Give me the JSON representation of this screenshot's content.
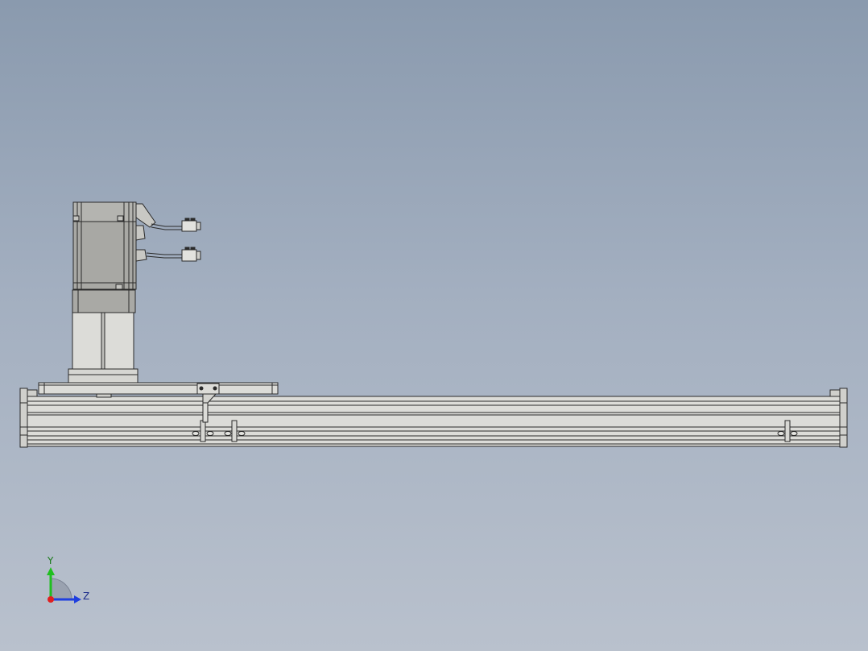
{
  "viewport": {
    "background_top": "#8a9aae",
    "background_bottom": "#b9c1cd",
    "part_fill": "#d8d8d4",
    "part_stroke": "#2a2a2a"
  },
  "triad": {
    "y_label": "Y",
    "z_label": "Z",
    "y_color": "#1fbf1f",
    "z_color": "#1f3fdf",
    "x_color": "#e01f1f"
  }
}
